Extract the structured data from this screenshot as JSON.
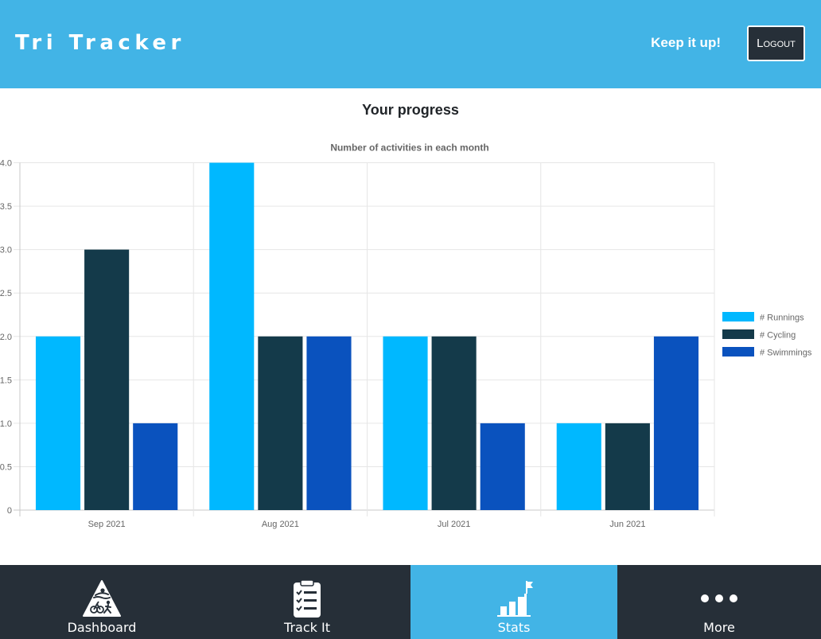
{
  "header": {
    "title": "Tri Tracker",
    "motto": "Keep it up!",
    "logout_label": "Logout"
  },
  "page": {
    "title": "Your progress"
  },
  "chart_data": {
    "type": "bar",
    "title": "Number of activities in each month",
    "categories": [
      "Sep 2021",
      "Aug 2021",
      "Jul 2021",
      "Jun 2021"
    ],
    "series": [
      {
        "name": "# Runnings",
        "values": [
          2,
          4,
          2,
          1
        ],
        "color": "#00b8ff"
      },
      {
        "name": "# Cycling",
        "values": [
          3,
          2,
          2,
          1
        ],
        "color": "#143a4a"
      },
      {
        "name": "# Swimmings",
        "values": [
          1,
          2,
          1,
          2
        ],
        "color": "#0a52be"
      }
    ],
    "ylim": [
      0,
      4
    ],
    "yticks": [
      "0",
      "0.5",
      "1.0",
      "1.5",
      "2.0",
      "2.5",
      "3.0",
      "3.5",
      "4.0"
    ],
    "grid": true,
    "legend": "right"
  },
  "nav": {
    "items": [
      {
        "label": "Dashboard",
        "icon": "triathlon-icon",
        "active": false
      },
      {
        "label": "Track It",
        "icon": "clipboard-checklist-icon",
        "active": false
      },
      {
        "label": "Stats",
        "icon": "stats-flag-icon",
        "active": true
      },
      {
        "label": "More",
        "icon": "more-dots-icon",
        "active": false
      }
    ]
  },
  "colors": {
    "header_bg": "#42b4e6",
    "nav_bg": "#262f38",
    "nav_active_bg": "#42b4e6"
  }
}
